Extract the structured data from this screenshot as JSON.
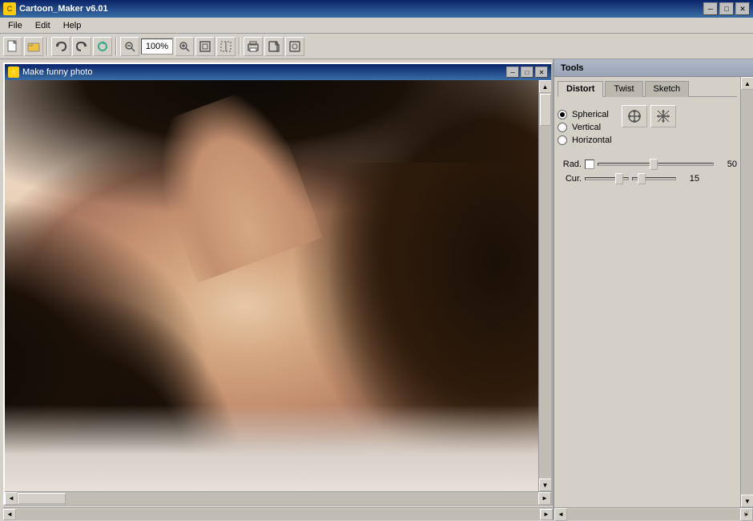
{
  "titleBar": {
    "title": "Cartoon_Maker v6.01",
    "minimizeLabel": "─",
    "maximizeLabel": "□",
    "closeLabel": "✕"
  },
  "menuBar": {
    "items": [
      {
        "label": "File"
      },
      {
        "label": "Edit"
      },
      {
        "label": "Help"
      }
    ]
  },
  "toolbar": {
    "zoomLevel": "100%",
    "buttons": [
      {
        "name": "new",
        "icon": "🖫"
      },
      {
        "name": "open",
        "icon": "📂"
      },
      {
        "name": "undo",
        "icon": "↩"
      },
      {
        "name": "redo",
        "icon": "↪"
      },
      {
        "name": "refresh",
        "icon": "🔄"
      },
      {
        "name": "zoom-out",
        "icon": "−"
      },
      {
        "name": "zoom-in",
        "icon": "+"
      },
      {
        "name": "fit",
        "icon": "⊞"
      },
      {
        "name": "select",
        "icon": "⊹"
      },
      {
        "name": "print",
        "icon": "🖶"
      },
      {
        "name": "export",
        "icon": "⤴"
      },
      {
        "name": "extra",
        "icon": "⊡"
      }
    ]
  },
  "innerWindow": {
    "title": "Make funny photo",
    "minimizeLabel": "─",
    "maximizeLabel": "□",
    "closeLabel": "✕"
  },
  "tools": {
    "title": "Tools",
    "tabs": [
      {
        "label": "Distort",
        "active": true
      },
      {
        "label": "Twist",
        "active": false
      },
      {
        "label": "Sketch",
        "active": false
      }
    ],
    "distort": {
      "radioOptions": [
        {
          "label": "Spherical",
          "selected": true
        },
        {
          "label": "Vertical",
          "selected": false
        },
        {
          "label": "Horizontal",
          "selected": false
        }
      ],
      "toolButtons": [
        {
          "name": "move-tool",
          "icon": "✛"
        },
        {
          "name": "distort-tool",
          "icon": "⊹"
        }
      ],
      "radLabel": "Rad.",
      "radValue": "50",
      "curLabel": "Cur.",
      "curValue": "15"
    }
  }
}
